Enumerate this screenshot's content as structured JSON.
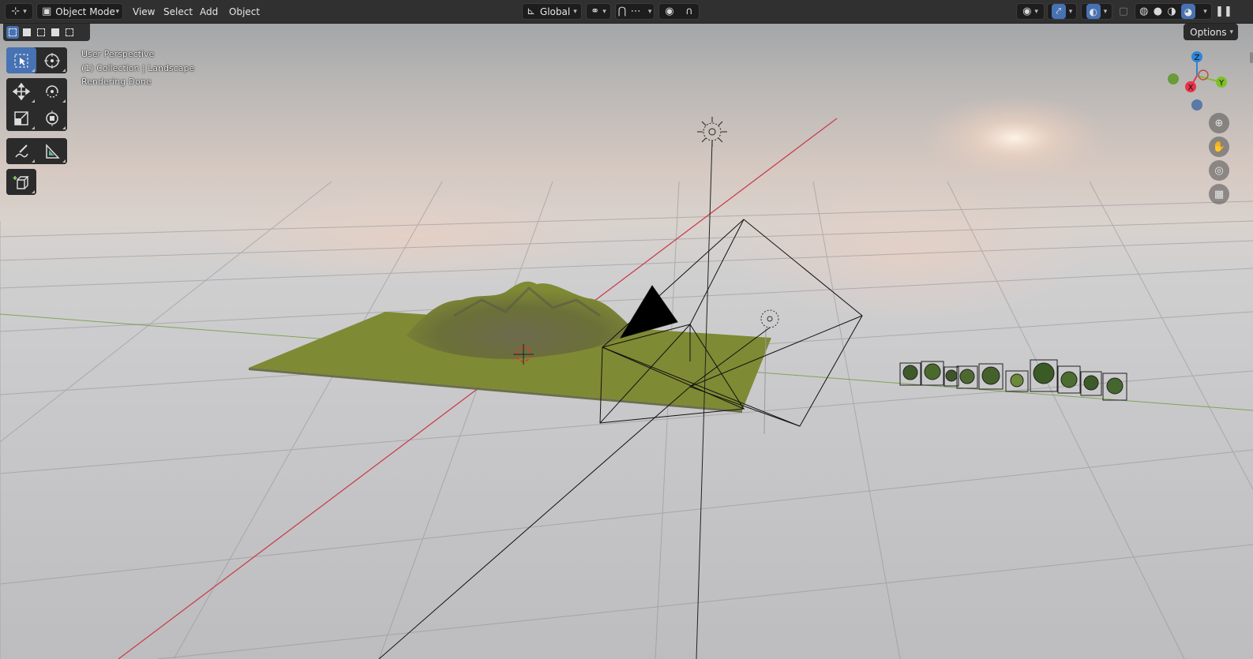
{
  "header": {
    "editor_type_icon": "editor-type-icon",
    "mode_label": "Object Mode",
    "menus": [
      "View",
      "Select",
      "Add",
      "Object"
    ],
    "orientation_label": "Global"
  },
  "overlay": {
    "view_name": "User Perspective",
    "collection": "(1) Collection | Landscape",
    "status": "Rendering Done"
  },
  "options_label": "Options",
  "gizmo": {
    "z_label": "Z",
    "y_label": "Y",
    "x_label": "X"
  },
  "colors": {
    "accent": "#4772b3",
    "header_bg": "#303030",
    "axis_x": "#e8334a",
    "axis_y": "#7ec026",
    "axis_z": "#2e84d8",
    "terrain": "#7f8a34"
  },
  "icons": {
    "select_box": "select-box-icon",
    "cursor": "cursor-icon",
    "move": "move-icon",
    "rotate": "rotate-icon",
    "scale": "scale-icon",
    "transform": "transform-icon",
    "annotate": "annotate-icon",
    "measure": "measure-icon",
    "add_cube": "add-cube-icon",
    "zoom": "zoom-icon",
    "pan": "hand-icon",
    "camera": "camera-icon",
    "grid": "grid-icon"
  }
}
